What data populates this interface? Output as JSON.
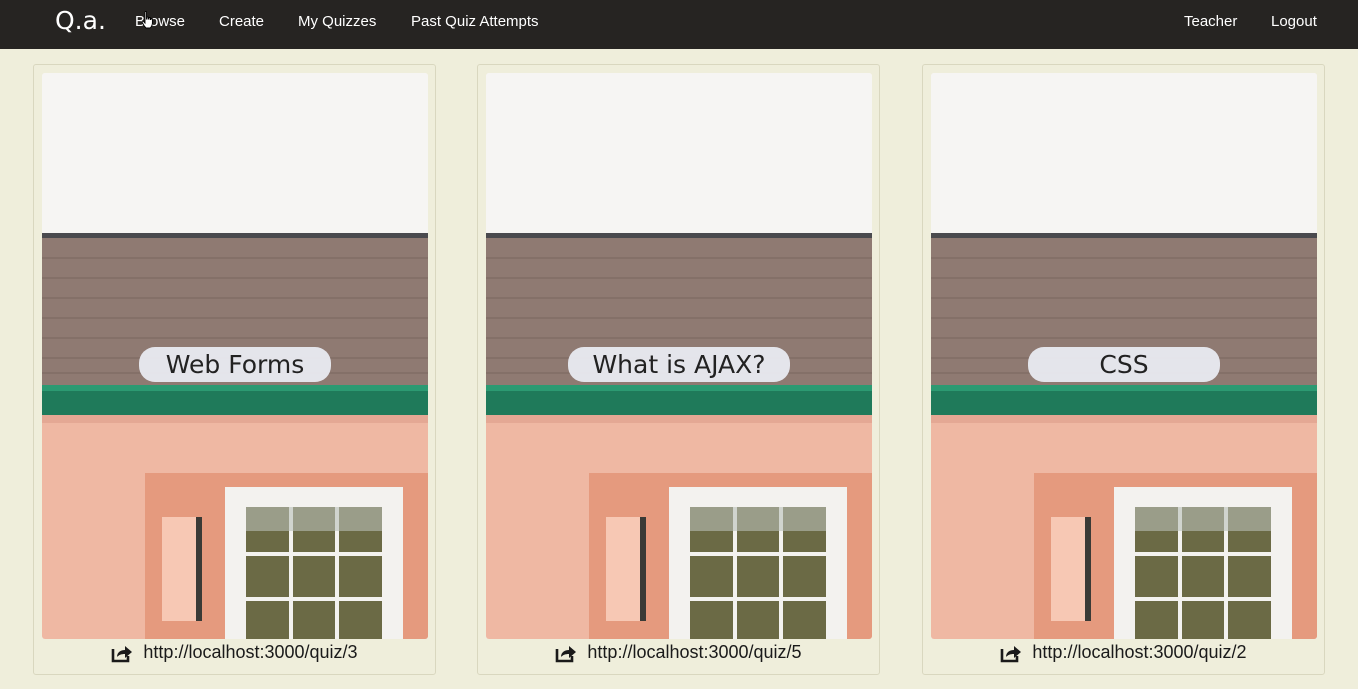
{
  "navbar": {
    "brand": "Q.a.",
    "links": {
      "browse": "Browse",
      "create": "Create",
      "my_quizzes": "My Quizzes",
      "past_quiz_attempts": "Past Quiz Attempts"
    },
    "right": {
      "teacher": "Teacher",
      "logout": "Logout"
    }
  },
  "quizzes": [
    {
      "title": "Web Forms",
      "link": "http://localhost:3000/quiz/3"
    },
    {
      "title": "What is AJAX?",
      "link": "http://localhost:3000/quiz/5"
    },
    {
      "title": "CSS",
      "link": "http://localhost:3000/quiz/2"
    }
  ],
  "icons": {
    "share": "share-icon",
    "cursor": "hand-pointer-icon"
  },
  "colors": {
    "navbar_bg": "#262422",
    "page_bg": "#efeedb",
    "roof": "#8f7a72",
    "gutter": "#1f7a5a",
    "wall": "#efb8a3",
    "window_frame": "#f3f2ef",
    "curtain": "#6b6a45"
  }
}
